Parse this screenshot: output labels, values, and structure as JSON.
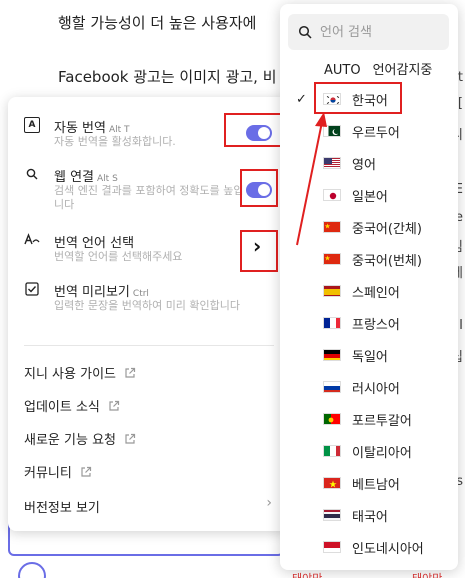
{
  "background": {
    "line1": "행할 가능성이 더 높은 사용자에",
    "line2": "Facebook 광고는 이미지 광고, 비",
    "right_fragments": [
      "t",
      "[",
      "디",
      "E",
      "ce",
      "김",
      "세",
      "II",
      "십",
      "ts"
    ],
    "bottom_fragments": [
      "태야만",
      "태야만"
    ]
  },
  "settings": {
    "auto_translate": {
      "title": "자동 번역",
      "shortcut": "Alt T",
      "desc": "자동 번역을 활성화합니다."
    },
    "web_link": {
      "title": "웹 연결",
      "shortcut": "Alt S",
      "desc": "검색 엔진 결과를 포함하여 정확도를 높입니다"
    },
    "translate_lang": {
      "title": "번역 언어 선택",
      "desc": "번역할 언어를 선택해주세요"
    },
    "preview": {
      "title": "번역 미리보기",
      "shortcut": "Ctrl",
      "desc": "입력한 문장을 번역하여 미리 확인합니다"
    },
    "links": [
      {
        "label": "지니 사용 가이드"
      },
      {
        "label": "업데이트 소식"
      },
      {
        "label": "새로운 기능 요청"
      },
      {
        "label": "커뮤니티"
      },
      {
        "label": "버전정보 보기"
      }
    ],
    "arrow_glyph": "›",
    "chevron_glyph": "›"
  },
  "languages": {
    "search_placeholder": "언어 검색",
    "auto_tag": "AUTO",
    "auto_label": "언어감지중",
    "check_glyph": "✓",
    "items": [
      {
        "label": "한국어",
        "flag": "kr",
        "selected": true
      },
      {
        "label": "우르두어",
        "flag": "pk"
      },
      {
        "label": "영어",
        "flag": "us"
      },
      {
        "label": "일본어",
        "flag": "jp"
      },
      {
        "label": "중국어(간체)",
        "flag": "cn"
      },
      {
        "label": "중국어(번체)",
        "flag": "cn"
      },
      {
        "label": "스페인어",
        "flag": "es"
      },
      {
        "label": "프랑스어",
        "flag": "fr"
      },
      {
        "label": "독일어",
        "flag": "de"
      },
      {
        "label": "러시아어",
        "flag": "ru"
      },
      {
        "label": "포르투갈어",
        "flag": "pt"
      },
      {
        "label": "이탈리아어",
        "flag": "it"
      },
      {
        "label": "베트남어",
        "flag": "vn"
      },
      {
        "label": "태국어",
        "flag": "th"
      },
      {
        "label": "인도네시아어",
        "flag": "id"
      }
    ]
  },
  "colors": {
    "accent": "#6a6de6",
    "highlight": "#e02020"
  }
}
